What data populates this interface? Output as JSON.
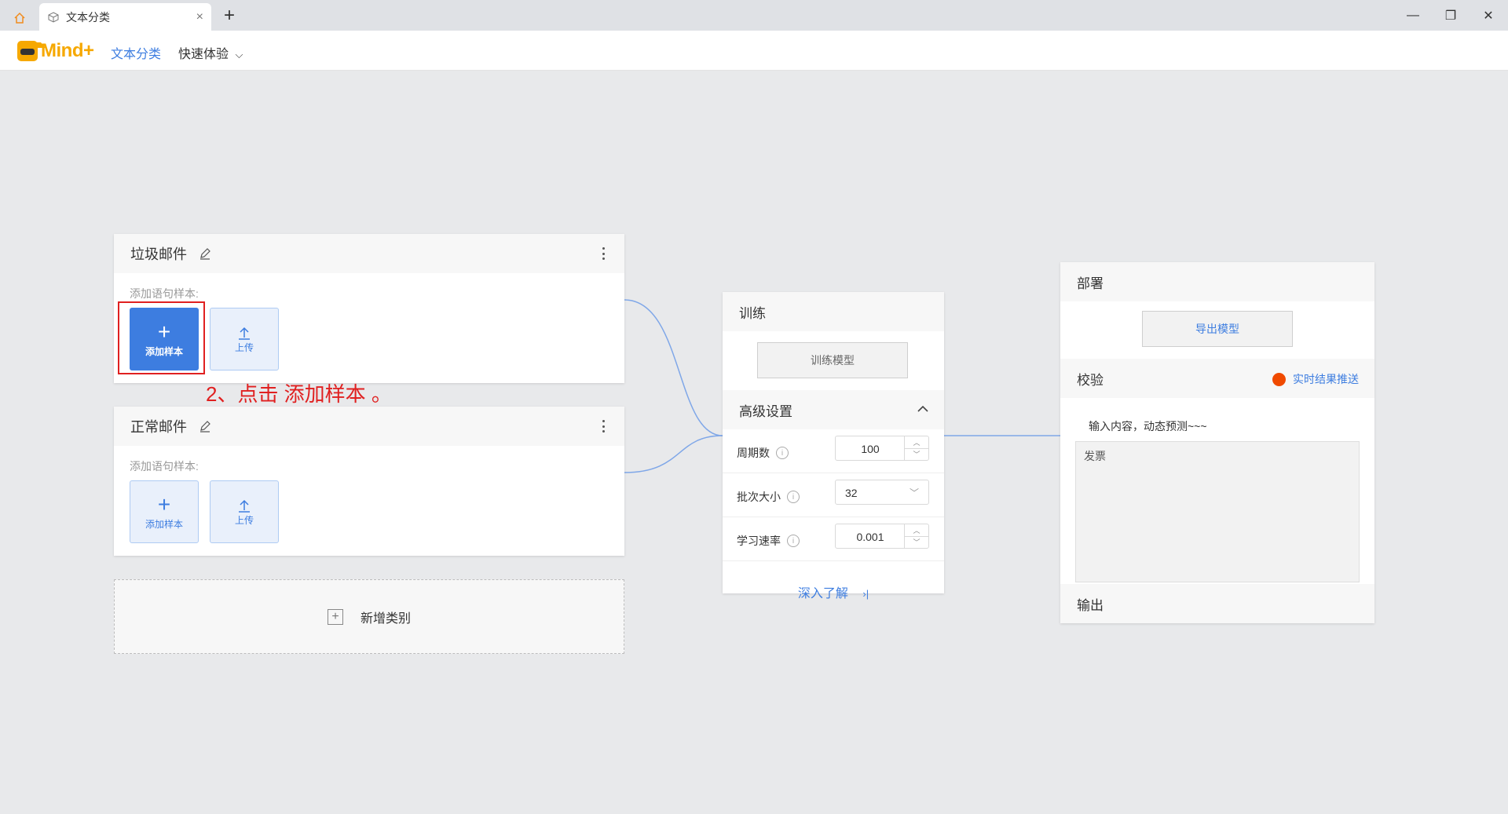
{
  "window": {
    "tab_title": "文本分类",
    "tab_close": "×",
    "new_tab": "+",
    "minimize": "—",
    "restore": "❐",
    "close": "✕"
  },
  "app": {
    "logo_text": "Mind+",
    "nav_current": "文本分类",
    "nav_quick": "快速体验",
    "nav_quick_chevron": "⌵"
  },
  "categories": [
    {
      "title": "垃圾邮件",
      "hint": "添加语句样本:",
      "add_label": "添加样本",
      "upload_label": "上传"
    },
    {
      "title": "正常邮件",
      "hint": "添加语句样本:",
      "add_label": "添加样本",
      "upload_label": "上传"
    }
  ],
  "annotation": "2、点击 添加样本 。",
  "add_category_label": "新增类别",
  "train": {
    "title": "训练",
    "train_button": "训练模型",
    "advanced_title": "高级设置",
    "params": [
      {
        "label": "周期数",
        "value": "100",
        "control": "stepper"
      },
      {
        "label": "批次大小",
        "value": "32",
        "control": "select"
      },
      {
        "label": "学习速率",
        "value": "0.001",
        "control": "stepper"
      }
    ],
    "learn_more": "深入了解",
    "learn_more_icon": "›|"
  },
  "deploy": {
    "title": "部署",
    "export_button": "导出模型",
    "verify_title": "校验",
    "live_push": "实时结果推送",
    "predict_hint": "输入内容，动态预测~~~",
    "predict_input": "发票",
    "output_title": "输出"
  },
  "colors": {
    "accent": "#3d7de0",
    "annotation": "#e02020",
    "live_dot": "#f04a00",
    "logo": "#f6a800"
  }
}
